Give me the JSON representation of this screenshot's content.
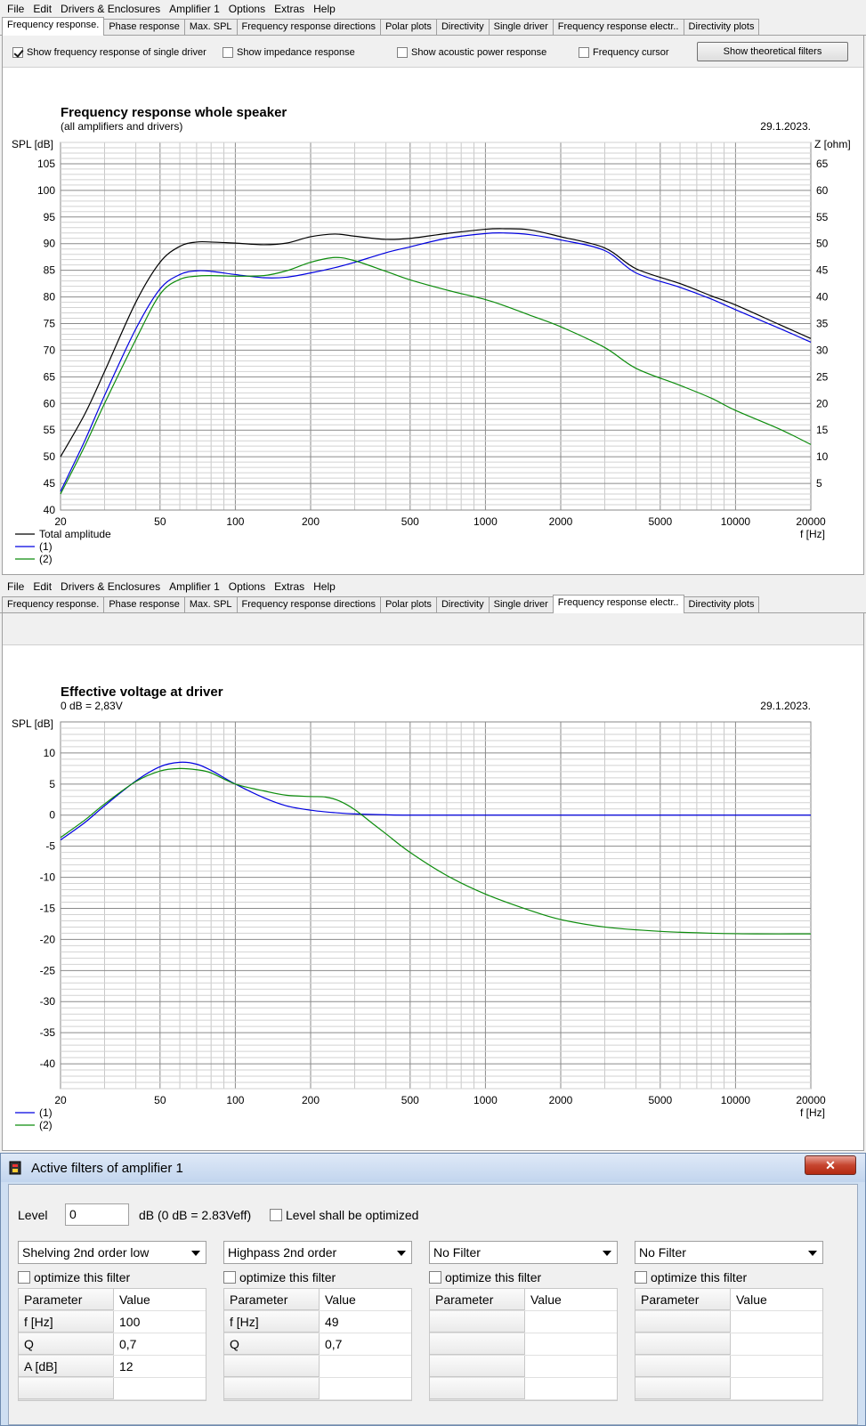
{
  "menu": [
    "File",
    "Edit",
    "Drivers & Enclosures",
    "Amplifier 1",
    "Options",
    "Extras",
    "Help"
  ],
  "tabs": [
    "Frequency response.",
    "Phase response",
    "Max. SPL",
    "Frequency response directions",
    "Polar plots",
    "Directivity",
    "Single driver",
    "Frequency response electr..",
    "Directivity plots"
  ],
  "top_options": {
    "single_driver": "Show frequency response of single driver",
    "impedance": "Show impedance response",
    "acoustic_power": "Show acoustic power response",
    "frequency_cursor": "Frequency cursor",
    "theoretical_filters": "Show theoretical filters"
  },
  "colors": {
    "total": "#000000",
    "driver1": "#0000e0",
    "driver2": "#0c8c0c",
    "grid": "#808080",
    "gridminor": "#c8c8c8"
  },
  "chart_data": [
    {
      "type": "line",
      "title": "Frequency response whole speaker",
      "subtitle": "(all amplifiers and drivers)",
      "date": "29.1.2023.",
      "ylabel": "SPL [dB]",
      "y2label": "Z [ohm]",
      "xlabel": "f [Hz]",
      "xscale": "log",
      "xlim": [
        20,
        20000
      ],
      "ylim": [
        40,
        109
      ],
      "y2lim": [
        0,
        69
      ],
      "xticks": [
        "20",
        "50",
        "100",
        "200",
        "500",
        "1000",
        "2000",
        "5000",
        "10000",
        "20000"
      ],
      "yticks": [
        "40",
        "45",
        "50",
        "55",
        "60",
        "65",
        "70",
        "75",
        "80",
        "85",
        "90",
        "95",
        "100",
        "105"
      ],
      "y2ticks": [
        "5",
        "10",
        "15",
        "20",
        "25",
        "30",
        "35",
        "40",
        "45",
        "50",
        "55",
        "60",
        "65"
      ],
      "legend": [
        "Total amplitude",
        "(1)",
        "(2)"
      ],
      "series": [
        {
          "name": "Total amplitude",
          "color": "total",
          "x": [
            20,
            25,
            30,
            40,
            50,
            60,
            70,
            80,
            100,
            130,
            160,
            200,
            250,
            300,
            400,
            500,
            700,
            1000,
            1200,
            1500,
            2000,
            3000,
            4000,
            6000,
            8000,
            10000,
            15000,
            20000
          ],
          "y": [
            50,
            58,
            66,
            79,
            86.5,
            89.5,
            90.3,
            90.3,
            90.1,
            89.8,
            90.1,
            91.3,
            91.8,
            91.4,
            90.8,
            91,
            91.9,
            92.7,
            92.8,
            92.6,
            91.3,
            89.2,
            85.3,
            82.5,
            80.2,
            78.5,
            74.8,
            72.2
          ]
        },
        {
          "name": "(1)",
          "color": "driver1",
          "x": [
            20,
            25,
            30,
            40,
            50,
            60,
            70,
            80,
            100,
            130,
            160,
            200,
            250,
            300,
            400,
            500,
            700,
            1000,
            1200,
            1500,
            2000,
            3000,
            4000,
            6000,
            8000,
            10000,
            15000,
            20000
          ],
          "y": [
            43.5,
            53,
            61.5,
            74,
            81.5,
            84.2,
            84.9,
            84.8,
            84.2,
            83.6,
            83.7,
            84.5,
            85.5,
            86.5,
            88.3,
            89.4,
            91,
            91.9,
            92,
            91.7,
            90.7,
            88.7,
            84.5,
            81.8,
            79.6,
            77.6,
            74.1,
            71.5
          ]
        },
        {
          "name": "(2)",
          "color": "driver2",
          "x": [
            20,
            25,
            30,
            40,
            50,
            60,
            70,
            80,
            100,
            130,
            160,
            200,
            250,
            300,
            400,
            500,
            700,
            1000,
            1200,
            1500,
            2000,
            3000,
            4000,
            6000,
            8000,
            10000,
            15000,
            20000
          ],
          "y": [
            43,
            52,
            60,
            72,
            80.5,
            83.3,
            83.9,
            84,
            83.9,
            84,
            84.9,
            86.5,
            87.4,
            86.8,
            84.8,
            83.2,
            81.3,
            79.5,
            78.3,
            76.6,
            74.4,
            70.5,
            66.6,
            63.4,
            61,
            58.7,
            55.2,
            52.3
          ]
        }
      ]
    },
    {
      "type": "line",
      "title": "Effective voltage at driver",
      "subtitle": "0 dB = 2,83V",
      "date": "29.1.2023.",
      "ylabel": "SPL [dB]",
      "xlabel": "f [Hz]",
      "xscale": "log",
      "xlim": [
        20,
        20000
      ],
      "ylim": [
        -44,
        15
      ],
      "xticks": [
        "20",
        "50",
        "100",
        "200",
        "500",
        "1000",
        "2000",
        "5000",
        "10000",
        "20000"
      ],
      "yticks": [
        "10",
        "5",
        "0",
        "-5",
        "-10",
        "-15",
        "-20",
        "-25",
        "-30",
        "-35",
        "-40"
      ],
      "legend": [
        "(1)",
        "(2)"
      ],
      "series": [
        {
          "name": "(1)",
          "color": "driver1",
          "x": [
            20,
            25,
            30,
            40,
            50,
            60,
            70,
            80,
            100,
            130,
            160,
            200,
            250,
            300,
            400,
            500,
            1000,
            20000
          ],
          "y": [
            -4,
            -1.2,
            1.5,
            5.5,
            7.8,
            8.5,
            8.2,
            7.2,
            5,
            2.8,
            1.5,
            0.8,
            0.4,
            0.2,
            0.05,
            0,
            0,
            0
          ]
        },
        {
          "name": "(2)",
          "color": "driver2",
          "x": [
            20,
            25,
            30,
            40,
            50,
            60,
            70,
            80,
            100,
            130,
            160,
            200,
            230,
            260,
            300,
            350,
            400,
            500,
            700,
            1000,
            1500,
            2000,
            3000,
            5000,
            8000,
            12000,
            20000
          ],
          "y": [
            -3.6,
            -0.8,
            1.8,
            5.4,
            7.1,
            7.5,
            7.3,
            6.8,
            5,
            3.9,
            3.2,
            3,
            2.9,
            2.3,
            0.9,
            -1.2,
            -3,
            -6,
            -9.7,
            -12.7,
            -15.3,
            -16.8,
            -18,
            -18.7,
            -19,
            -19.1,
            -19.1
          ]
        }
      ]
    }
  ],
  "dialog": {
    "title": "Active filters of amplifier 1",
    "close": "✕",
    "level_label": "Level",
    "level_value": "0",
    "level_unit": "dB (0 dB = 2.83Veff)",
    "level_optimize": "Level shall be optimized",
    "optimize_label": "optimize this filter",
    "col_param": "Parameter",
    "col_value": "Value",
    "filters": [
      {
        "type": "Shelving 2nd order low",
        "params": [
          [
            "f [Hz]",
            "100"
          ],
          [
            "Q",
            "0,7"
          ],
          [
            "A [dB]",
            "12"
          ],
          [
            "",
            ""
          ]
        ]
      },
      {
        "type": "Highpass 2nd order",
        "params": [
          [
            "f [Hz]",
            "49"
          ],
          [
            "Q",
            "0,7"
          ],
          [
            "",
            ""
          ],
          [
            "",
            ""
          ]
        ]
      },
      {
        "type": "No Filter",
        "params": [
          [
            "",
            ""
          ],
          [
            "",
            ""
          ],
          [
            "",
            ""
          ],
          [
            "",
            ""
          ]
        ]
      },
      {
        "type": "No Filter",
        "params": [
          [
            "",
            ""
          ],
          [
            "",
            ""
          ],
          [
            "",
            ""
          ],
          [
            "",
            ""
          ]
        ]
      }
    ]
  }
}
